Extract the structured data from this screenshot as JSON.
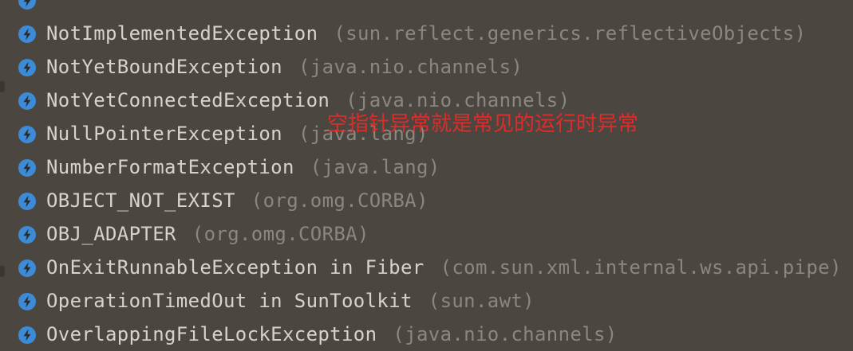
{
  "colors": {
    "background": "#4b4740",
    "name_text": "#d6d3cc",
    "package_text": "#8a8780",
    "icon_fill": "#3d8bd6",
    "annotation": "#e02b2b"
  },
  "items": [
    {
      "name": "",
      "package": "",
      "icon": "exception-class-icon"
    },
    {
      "name": "NotImplementedException",
      "package": "(sun.reflect.generics.reflectiveObjects)",
      "icon": "exception-class-icon"
    },
    {
      "name": "NotYetBoundException",
      "package": "(java.nio.channels)",
      "icon": "exception-class-icon"
    },
    {
      "name": "NotYetConnectedException",
      "package": "(java.nio.channels)",
      "icon": "exception-class-icon"
    },
    {
      "name": "NullPointerException",
      "package": "(java.lang)",
      "icon": "exception-class-icon"
    },
    {
      "name": "NumberFormatException",
      "package": "(java.lang)",
      "icon": "exception-class-icon"
    },
    {
      "name": "OBJECT_NOT_EXIST",
      "package": "(org.omg.CORBA)",
      "icon": "exception-class-icon"
    },
    {
      "name": "OBJ_ADAPTER",
      "package": "(org.omg.CORBA)",
      "icon": "exception-class-icon"
    },
    {
      "name": "OnExitRunnableException in Fiber",
      "package": "(com.sun.xml.internal.ws.api.pipe)",
      "icon": "exception-class-icon"
    },
    {
      "name": "OperationTimedOut in SunToolkit",
      "package": "(sun.awt)",
      "icon": "exception-class-icon"
    },
    {
      "name": "OverlappingFileLockException",
      "package": "(java.nio.channels)",
      "icon": "exception-class-icon"
    }
  ],
  "annotation": {
    "text": "空指针异常就是常见的运行时异常"
  }
}
